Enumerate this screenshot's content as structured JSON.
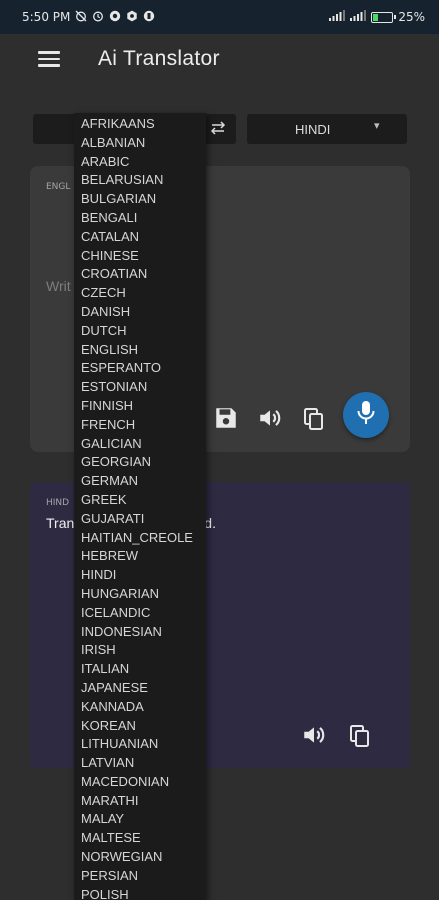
{
  "status_bar": {
    "time": "5:50 PM",
    "battery": "25%",
    "battery_level": 0.25,
    "battery_color": "#4cd964",
    "left_icons": [
      "alarm-off-icon",
      "alarm-icon",
      "notification-icon",
      "settings-icon",
      "notification-icon"
    ],
    "right_icons": [
      "signal-icon",
      "signal-icon",
      "battery-charging-icon"
    ]
  },
  "app_bar": {
    "title": "Ai Translator",
    "menu_icon": "hamburger-menu-icon"
  },
  "language_bar": {
    "swap_icon": "swap-arrows-icon",
    "target_language": "HINDI",
    "chevron_icon": "chevron-down-icon"
  },
  "input_card": {
    "label": "ENGL",
    "placeholder": "Writ",
    "background": "#3a3a3a",
    "actions": [
      "save-icon",
      "speaker-icon",
      "copy-icon",
      "mic-icon"
    ],
    "mic_color": "#1f6fb1"
  },
  "output_card": {
    "label": "HIND",
    "text": "Tran",
    "text_tail": "d.",
    "background": "#2d2a42",
    "actions": [
      "speaker-icon",
      "copy-icon"
    ]
  },
  "language_dropdown": {
    "items": [
      "AFRIKAANS",
      "ALBANIAN",
      "ARABIC",
      "BELARUSIAN",
      "BULGARIAN",
      "BENGALI",
      "CATALAN",
      "CHINESE",
      "CROATIAN",
      "CZECH",
      "DANISH",
      "DUTCH",
      "ENGLISH",
      "ESPERANTO",
      "ESTONIAN",
      "FINNISH",
      "FRENCH",
      "GALICIAN",
      "GEORGIAN",
      "GERMAN",
      "GREEK",
      "GUJARATI",
      "HAITIAN_CREOLE",
      "HEBREW",
      "HINDI",
      "HUNGARIAN",
      "ICELANDIC",
      "INDONESIAN",
      "IRISH",
      "ITALIAN",
      "JAPANESE",
      "KANNADA",
      "KOREAN",
      "LITHUANIAN",
      "LATVIAN",
      "MACEDONIAN",
      "MARATHI",
      "MALAY",
      "MALTESE",
      "NORWEGIAN",
      "PERSIAN",
      "POLISH"
    ]
  }
}
